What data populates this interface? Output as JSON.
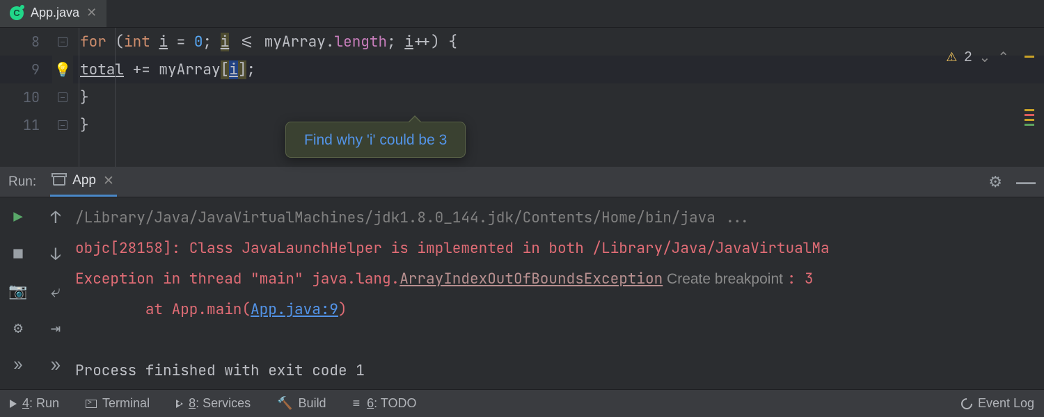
{
  "tab": {
    "filename": "App.java"
  },
  "editor": {
    "lines": [
      "8",
      "9",
      "10",
      "11"
    ],
    "code8": {
      "for": "for",
      "open": " (",
      "int": "int",
      "sp": " ",
      "i1": "i",
      "eq": " = ",
      "zero": "0",
      "semi1": "; ",
      "i2": "i",
      "lte": " <= ",
      "arr": "myArray",
      "dot": ".",
      "len": "length",
      "semi2": "; ",
      "i3": "i",
      "inc": "++",
      "close": ") {"
    },
    "code9": {
      "total": "total",
      "pluseq": " += ",
      "arr": "myArray",
      "lb": "[",
      "i": "i",
      "rb": "]",
      "semi": ";"
    },
    "code10": "}",
    "code11": "}",
    "warn_count": "2",
    "bulb": "💡"
  },
  "hint": {
    "text": "Find why 'i' could be 3"
  },
  "run": {
    "label": "Run:",
    "tab": "App",
    "path": "/Library/Java/JavaVirtualMachines/jdk1.8.0_144.jdk/Contents/Home/bin/java ...",
    "objc": "objc[28158]: Class JavaLaunchHelper is implemented in both /Library/Java/JavaVirtualMa",
    "exc1": "Exception in thread \"main\" java.lang.",
    "exc_link": "ArrayIndexOutOfBoundsException",
    "cb": " Create breakpoint ",
    "exc_tail": ": 3",
    "at1": "\tat App.main(",
    "at_link": "App.java:9",
    "at2": ")",
    "finished": "Process finished with exit code 1"
  },
  "status": {
    "run": "4: Run",
    "terminal": "Terminal",
    "services": "8: Services",
    "build": "Build",
    "todo": "6: TODO",
    "eventlog": "Event Log"
  }
}
